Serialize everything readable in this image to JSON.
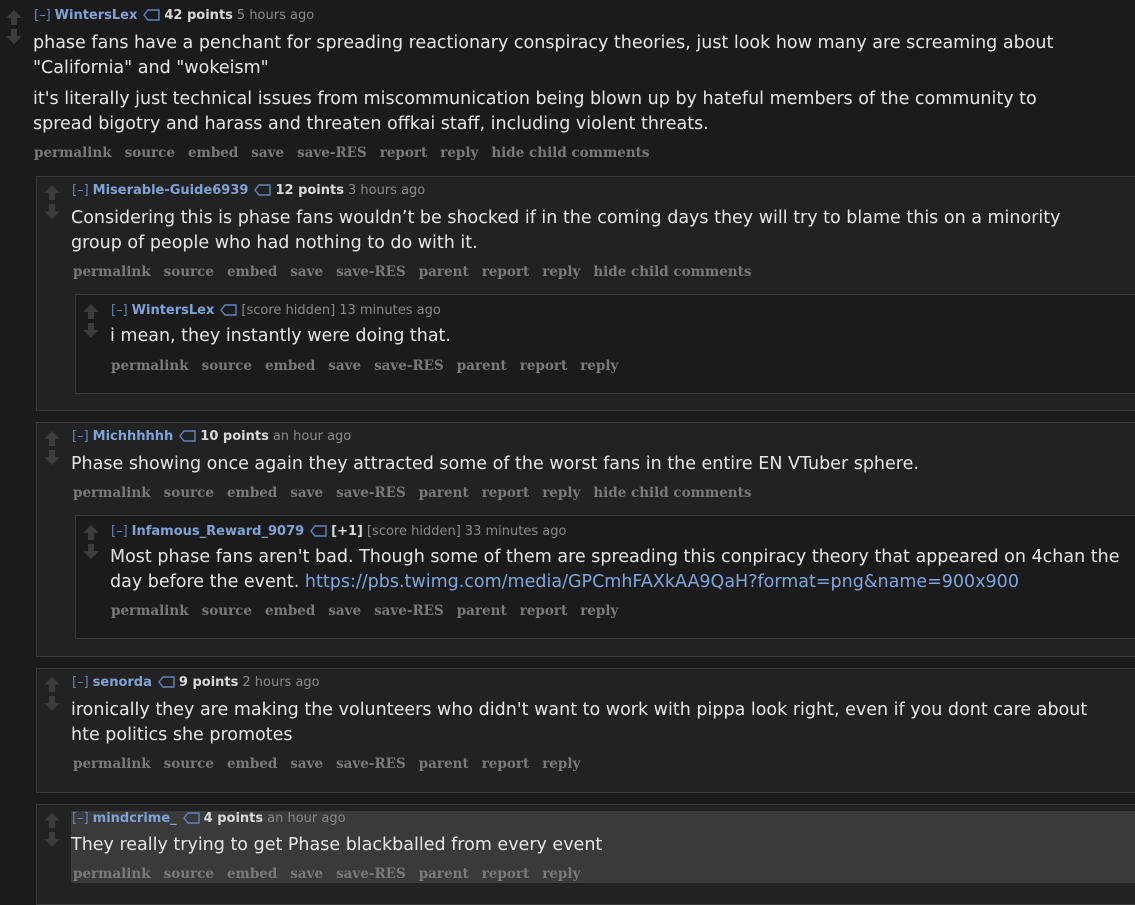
{
  "colors": {
    "background": "#1b1b1b",
    "author": "#7ea3d6",
    "link": "#7aa7e0",
    "button_text": "#7a7a7a",
    "body_text": "#e6e6e6",
    "highlight": "#3a3a3a"
  },
  "icons": {
    "upvote": "upvote-arrow-icon",
    "downvote": "downvote-arrow-icon",
    "tag": "tag-icon"
  },
  "comments": [
    {
      "expand": "[–]",
      "author": "WintersLex",
      "score": "42 points",
      "time": "5 hours ago",
      "paragraphs": [
        "phase fans have a penchant for spreading reactionary conspiracy theories, just look how many are screaming about \"California\" and \"wokeism\"",
        "it's literally just technical issues from miscommunication being blown up by hateful members of the community to spread bigotry and harass and threaten offkai staff, including violent threats."
      ],
      "buttons": [
        "permalink",
        "source",
        "embed",
        "save",
        "save-RES",
        "report",
        "reply",
        "hide child comments"
      ]
    },
    {
      "expand": "[–]",
      "author": "Miserable-Guide6939",
      "score": "12 points",
      "time": "3 hours ago",
      "text": "Considering this is phase fans wouldn’t be shocked if in the coming days they will try to blame this on a minority group of people who had nothing to do with it.",
      "buttons": [
        "permalink",
        "source",
        "embed",
        "save",
        "save-RES",
        "parent",
        "report",
        "reply",
        "hide child comments"
      ]
    },
    {
      "expand": "[–]",
      "author": "WintersLex",
      "score": "[score hidden]",
      "time": "13 minutes ago",
      "text": "i mean, they instantly were doing that.",
      "buttons": [
        "permalink",
        "source",
        "embed",
        "save",
        "save-RES",
        "parent",
        "report",
        "reply"
      ]
    },
    {
      "expand": "[–]",
      "author": "Michhhhhh",
      "score": "10 points",
      "time": "an hour ago",
      "text": "Phase showing once again they attracted some of the worst fans in the entire EN VTuber sphere.",
      "buttons": [
        "permalink",
        "source",
        "embed",
        "save",
        "save-RES",
        "parent",
        "report",
        "reply",
        "hide child comments"
      ]
    },
    {
      "expand": "[–]",
      "author": "Infamous_Reward_9079",
      "plus": "[+1]",
      "score": "[score hidden]",
      "time": "33 minutes ago",
      "text": "Most phase fans aren't bad. Though some of them are spreading this conpiracy theory that appeared on 4chan the day before the event.",
      "link": "https://pbs.twimg.com/media/GPCmhFAXkAA9QaH?format=png&name=900x900",
      "buttons": [
        "permalink",
        "source",
        "embed",
        "save",
        "save-RES",
        "parent",
        "report",
        "reply"
      ]
    },
    {
      "expand": "[–]",
      "author": "senorda",
      "score": "9 points",
      "time": "2 hours ago",
      "text": "ironically they are making the volunteers who didn't want to work with pippa look right, even if you dont care about hte politics she promotes",
      "buttons": [
        "permalink",
        "source",
        "embed",
        "save",
        "save-RES",
        "parent",
        "report",
        "reply"
      ]
    },
    {
      "expand": "[–]",
      "author": "mindcrime_",
      "score": "4 points",
      "time": "an hour ago",
      "text": "They really trying to get Phase blackballed from every event",
      "buttons": [
        "permalink",
        "source",
        "embed",
        "save",
        "save-RES",
        "parent",
        "report",
        "reply"
      ]
    }
  ]
}
